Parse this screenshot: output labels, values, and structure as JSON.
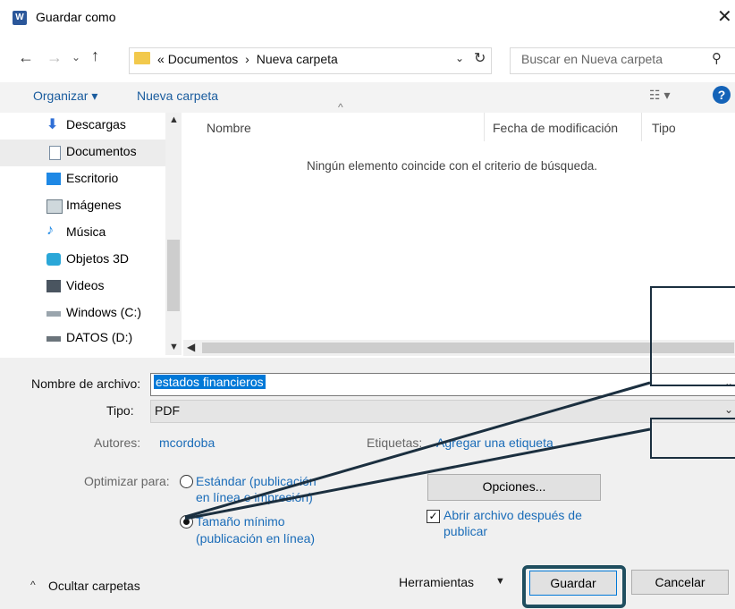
{
  "window": {
    "title": "Guardar como",
    "app_icon": "word-icon"
  },
  "address": {
    "crumbs": [
      "«",
      "Documentos",
      "›",
      "Nueva carpeta"
    ],
    "search_placeholder": "Buscar en Nueva carpeta"
  },
  "toolbar": {
    "organize": "Organizar ▾",
    "new_folder": "Nueva carpeta"
  },
  "nav": {
    "items": [
      {
        "label": "Descargas",
        "icon": "download-arrow-icon"
      },
      {
        "label": "Documentos",
        "icon": "document-icon",
        "selected": true
      },
      {
        "label": "Escritorio",
        "icon": "desktop-icon"
      },
      {
        "label": "Imágenes",
        "icon": "image-icon"
      },
      {
        "label": "Música",
        "icon": "music-icon"
      },
      {
        "label": "Objetos 3D",
        "icon": "cube-icon"
      },
      {
        "label": "Videos",
        "icon": "video-icon"
      },
      {
        "label": "Windows (C:)",
        "icon": "drive-icon"
      },
      {
        "label": "DATOS (D:)",
        "icon": "drive-icon"
      }
    ]
  },
  "file_list": {
    "columns": [
      "Nombre",
      "Fecha de modificación",
      "Tipo"
    ],
    "empty_message": "Ningún elemento coincide con el criterio de búsqueda."
  },
  "form": {
    "filename_label": "Nombre de archivo:",
    "filename_value": "estados financieros",
    "type_label": "Tipo:",
    "type_value": "PDF",
    "authors_label": "Autores:",
    "authors_value": "mcordoba",
    "tags_label": "Etiquetas:",
    "tags_value": "Agregar una etiqueta",
    "optimize_label": "Optimizar para:",
    "opt_standard_line1": "Estándar (publicación",
    "opt_standard_line2": "en línea e impresión)",
    "opt_min_line1": "Tamaño mínimo",
    "opt_min_line2": "(publicación en línea)",
    "options_button": "Opciones...",
    "open_after_line1": "Abrir archivo después de",
    "open_after_line2": "publicar"
  },
  "footer": {
    "hide_folders": "Ocultar carpetas",
    "tools": "Herramientas",
    "save": "Guardar",
    "cancel": "Cancelar"
  }
}
